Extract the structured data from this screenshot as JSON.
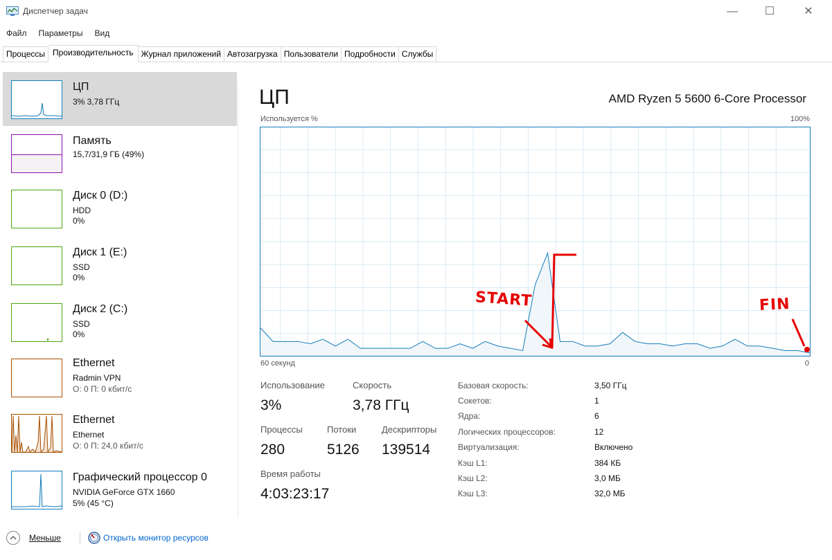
{
  "window": {
    "title": "Диспетчер задач",
    "minimize_glyph": "—",
    "maximize_glyph": "☐",
    "close_glyph": "✕"
  },
  "menu": [
    "Файл",
    "Параметры",
    "Вид"
  ],
  "tabs": [
    "Процессы",
    "Производительность",
    "Журнал приложений",
    "Автозагрузка",
    "Пользователи",
    "Подробности",
    "Службы"
  ],
  "active_tab": "Производительность",
  "sidebar": [
    {
      "title": "ЦП",
      "line1": "3% 3,78 ГГц",
      "line2": "",
      "color": "#117dbb",
      "selected": true
    },
    {
      "title": "Память",
      "line1": "15,7/31,9 ГБ (49%)",
      "line2": "",
      "color": "#8b12ae",
      "fill": 0.49
    },
    {
      "title": "Диск 0 (D:)",
      "line1": "HDD",
      "line2": "0%",
      "color": "#4da60c"
    },
    {
      "title": "Диск 1 (E:)",
      "line1": "SSD",
      "line2": "0%",
      "color": "#4da60c"
    },
    {
      "title": "Диск 2 (C:)",
      "line1": "SSD",
      "line2": "0%",
      "color": "#4da60c"
    },
    {
      "title": "Ethernet",
      "line1": "Radmin VPN",
      "line2": "О: 0 П: 0 кбит/с",
      "color": "#a74f01"
    },
    {
      "title": "Ethernet",
      "line1": "Ethernet",
      "line2": "О: 0 П: 24,0 кбит/с",
      "color": "#a74f01"
    },
    {
      "title": "Графический процессор 0",
      "line1": "NVIDIA GeForce GTX 1660",
      "line2": "5% (45 °C)",
      "color": "#117dbb"
    }
  ],
  "main": {
    "title": "ЦП",
    "cpu_model": "AMD Ryzen 5 5600 6-Core Processor",
    "graph_label_left": "Используется %",
    "graph_label_right": "100%",
    "graph_time_left": "60 секунд",
    "graph_time_right": "0",
    "stats": {
      "usage_label": "Использование",
      "usage_value": "3%",
      "speed_label": "Скорость",
      "speed_value": "3,78 ГГц",
      "processes_label": "Процессы",
      "processes_value": "280",
      "threads_label": "Потоки",
      "threads_value": "5126",
      "handles_label": "Дескрипторы",
      "handles_value": "139514",
      "uptime_label": "Время работы",
      "uptime_value": "4:03:23:17"
    },
    "specs": [
      {
        "label": "Базовая скорость:",
        "value": "3,50 ГГц"
      },
      {
        "label": "Сокетов:",
        "value": "1"
      },
      {
        "label": "Ядра:",
        "value": "6"
      },
      {
        "label": "Логических процессоров:",
        "value": "12"
      },
      {
        "label": "Виртуализация:",
        "value": "Включено"
      },
      {
        "label": "Кэш L1:",
        "value": "384 КБ"
      },
      {
        "label": "Кэш L2:",
        "value": "3,0 МБ"
      },
      {
        "label": "Кэш L3:",
        "value": "32,0 МБ"
      }
    ]
  },
  "annotations": {
    "start": "START",
    "fin": "FIN"
  },
  "footer": {
    "less_label": "Меньше",
    "resmon_label": "Открыть монитор ресурсов"
  },
  "chart_data": {
    "type": "area",
    "x": [
      60,
      58,
      56,
      54,
      52,
      50,
      48,
      46,
      44,
      42,
      40,
      38,
      36,
      34,
      32,
      30,
      28,
      26,
      24,
      22,
      20,
      18,
      16,
      14,
      12,
      10,
      8,
      6,
      4,
      2,
      0
    ],
    "values": [
      12,
      6,
      6,
      6,
      5,
      7,
      4,
      7,
      3,
      3,
      3,
      3,
      3,
      6,
      3,
      3,
      5,
      3,
      6,
      4,
      3,
      2,
      31,
      45,
      6,
      6,
      4,
      4,
      5,
      10,
      6,
      5,
      5,
      4,
      5,
      5,
      3,
      4,
      7,
      4,
      4,
      3,
      2,
      2,
      1
    ],
    "ylim": [
      0,
      100
    ],
    "xlabel": "60 секунд",
    "ylabel": "Используется %",
    "grid": true,
    "color": "#117dbb"
  }
}
